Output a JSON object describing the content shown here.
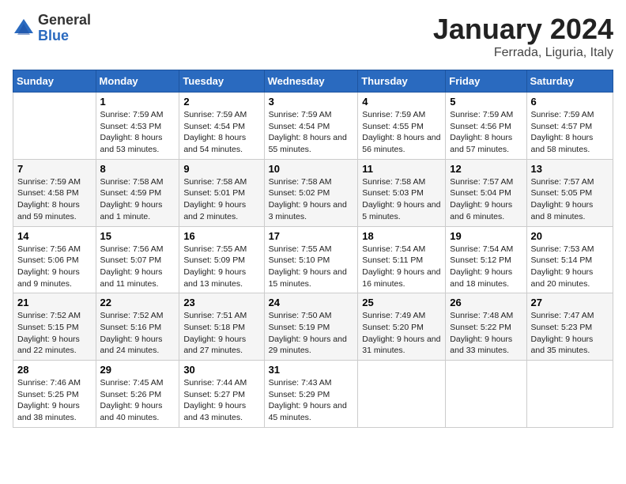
{
  "logo": {
    "general": "General",
    "blue": "Blue"
  },
  "title": "January 2024",
  "subtitle": "Ferrada, Liguria, Italy",
  "weekdays": [
    "Sunday",
    "Monday",
    "Tuesday",
    "Wednesday",
    "Thursday",
    "Friday",
    "Saturday"
  ],
  "weeks": [
    [
      {
        "num": "",
        "sunrise": "",
        "sunset": "",
        "daylight": ""
      },
      {
        "num": "1",
        "sunrise": "Sunrise: 7:59 AM",
        "sunset": "Sunset: 4:53 PM",
        "daylight": "Daylight: 8 hours and 53 minutes."
      },
      {
        "num": "2",
        "sunrise": "Sunrise: 7:59 AM",
        "sunset": "Sunset: 4:54 PM",
        "daylight": "Daylight: 8 hours and 54 minutes."
      },
      {
        "num": "3",
        "sunrise": "Sunrise: 7:59 AM",
        "sunset": "Sunset: 4:54 PM",
        "daylight": "Daylight: 8 hours and 55 minutes."
      },
      {
        "num": "4",
        "sunrise": "Sunrise: 7:59 AM",
        "sunset": "Sunset: 4:55 PM",
        "daylight": "Daylight: 8 hours and 56 minutes."
      },
      {
        "num": "5",
        "sunrise": "Sunrise: 7:59 AM",
        "sunset": "Sunset: 4:56 PM",
        "daylight": "Daylight: 8 hours and 57 minutes."
      },
      {
        "num": "6",
        "sunrise": "Sunrise: 7:59 AM",
        "sunset": "Sunset: 4:57 PM",
        "daylight": "Daylight: 8 hours and 58 minutes."
      }
    ],
    [
      {
        "num": "7",
        "sunrise": "Sunrise: 7:59 AM",
        "sunset": "Sunset: 4:58 PM",
        "daylight": "Daylight: 8 hours and 59 minutes."
      },
      {
        "num": "8",
        "sunrise": "Sunrise: 7:58 AM",
        "sunset": "Sunset: 4:59 PM",
        "daylight": "Daylight: 9 hours and 1 minute."
      },
      {
        "num": "9",
        "sunrise": "Sunrise: 7:58 AM",
        "sunset": "Sunset: 5:01 PM",
        "daylight": "Daylight: 9 hours and 2 minutes."
      },
      {
        "num": "10",
        "sunrise": "Sunrise: 7:58 AM",
        "sunset": "Sunset: 5:02 PM",
        "daylight": "Daylight: 9 hours and 3 minutes."
      },
      {
        "num": "11",
        "sunrise": "Sunrise: 7:58 AM",
        "sunset": "Sunset: 5:03 PM",
        "daylight": "Daylight: 9 hours and 5 minutes."
      },
      {
        "num": "12",
        "sunrise": "Sunrise: 7:57 AM",
        "sunset": "Sunset: 5:04 PM",
        "daylight": "Daylight: 9 hours and 6 minutes."
      },
      {
        "num": "13",
        "sunrise": "Sunrise: 7:57 AM",
        "sunset": "Sunset: 5:05 PM",
        "daylight": "Daylight: 9 hours and 8 minutes."
      }
    ],
    [
      {
        "num": "14",
        "sunrise": "Sunrise: 7:56 AM",
        "sunset": "Sunset: 5:06 PM",
        "daylight": "Daylight: 9 hours and 9 minutes."
      },
      {
        "num": "15",
        "sunrise": "Sunrise: 7:56 AM",
        "sunset": "Sunset: 5:07 PM",
        "daylight": "Daylight: 9 hours and 11 minutes."
      },
      {
        "num": "16",
        "sunrise": "Sunrise: 7:55 AM",
        "sunset": "Sunset: 5:09 PM",
        "daylight": "Daylight: 9 hours and 13 minutes."
      },
      {
        "num": "17",
        "sunrise": "Sunrise: 7:55 AM",
        "sunset": "Sunset: 5:10 PM",
        "daylight": "Daylight: 9 hours and 15 minutes."
      },
      {
        "num": "18",
        "sunrise": "Sunrise: 7:54 AM",
        "sunset": "Sunset: 5:11 PM",
        "daylight": "Daylight: 9 hours and 16 minutes."
      },
      {
        "num": "19",
        "sunrise": "Sunrise: 7:54 AM",
        "sunset": "Sunset: 5:12 PM",
        "daylight": "Daylight: 9 hours and 18 minutes."
      },
      {
        "num": "20",
        "sunrise": "Sunrise: 7:53 AM",
        "sunset": "Sunset: 5:14 PM",
        "daylight": "Daylight: 9 hours and 20 minutes."
      }
    ],
    [
      {
        "num": "21",
        "sunrise": "Sunrise: 7:52 AM",
        "sunset": "Sunset: 5:15 PM",
        "daylight": "Daylight: 9 hours and 22 minutes."
      },
      {
        "num": "22",
        "sunrise": "Sunrise: 7:52 AM",
        "sunset": "Sunset: 5:16 PM",
        "daylight": "Daylight: 9 hours and 24 minutes."
      },
      {
        "num": "23",
        "sunrise": "Sunrise: 7:51 AM",
        "sunset": "Sunset: 5:18 PM",
        "daylight": "Daylight: 9 hours and 27 minutes."
      },
      {
        "num": "24",
        "sunrise": "Sunrise: 7:50 AM",
        "sunset": "Sunset: 5:19 PM",
        "daylight": "Daylight: 9 hours and 29 minutes."
      },
      {
        "num": "25",
        "sunrise": "Sunrise: 7:49 AM",
        "sunset": "Sunset: 5:20 PM",
        "daylight": "Daylight: 9 hours and 31 minutes."
      },
      {
        "num": "26",
        "sunrise": "Sunrise: 7:48 AM",
        "sunset": "Sunset: 5:22 PM",
        "daylight": "Daylight: 9 hours and 33 minutes."
      },
      {
        "num": "27",
        "sunrise": "Sunrise: 7:47 AM",
        "sunset": "Sunset: 5:23 PM",
        "daylight": "Daylight: 9 hours and 35 minutes."
      }
    ],
    [
      {
        "num": "28",
        "sunrise": "Sunrise: 7:46 AM",
        "sunset": "Sunset: 5:25 PM",
        "daylight": "Daylight: 9 hours and 38 minutes."
      },
      {
        "num": "29",
        "sunrise": "Sunrise: 7:45 AM",
        "sunset": "Sunset: 5:26 PM",
        "daylight": "Daylight: 9 hours and 40 minutes."
      },
      {
        "num": "30",
        "sunrise": "Sunrise: 7:44 AM",
        "sunset": "Sunset: 5:27 PM",
        "daylight": "Daylight: 9 hours and 43 minutes."
      },
      {
        "num": "31",
        "sunrise": "Sunrise: 7:43 AM",
        "sunset": "Sunset: 5:29 PM",
        "daylight": "Daylight: 9 hours and 45 minutes."
      },
      {
        "num": "",
        "sunrise": "",
        "sunset": "",
        "daylight": ""
      },
      {
        "num": "",
        "sunrise": "",
        "sunset": "",
        "daylight": ""
      },
      {
        "num": "",
        "sunrise": "",
        "sunset": "",
        "daylight": ""
      }
    ]
  ]
}
